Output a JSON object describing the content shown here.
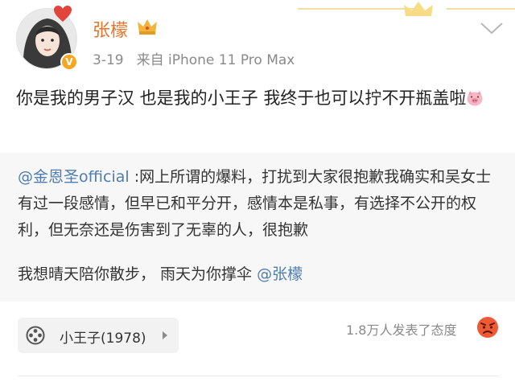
{
  "post": {
    "username": "张檬",
    "date": "3-19",
    "source": "来自 iPhone 11 Pro Max",
    "text": "你是我的男子汉 也是我的小王子 我终于也可以拧不开瓶盖啦"
  },
  "repost": {
    "mention": "@金恩圣official",
    "text": " :网上所谓的爆料，打扰到大家很抱歉我确实和吴女士有过一段感情，但早已和平分开，感情本是私事，有选择不公开的权利，但无奈还是伤害到了无辜的人，很抱歉",
    "quote_text": "我想晴天陪你散步，  雨天为你撑伞 ",
    "quote_mention": "@张檬"
  },
  "footer": {
    "music_title": "小王子(1978)",
    "reactions_text": "1.8万人发表了态度"
  },
  "colors": {
    "username": "#e5752a",
    "mention": "#507daf",
    "meta": "#8a8a8a",
    "repost_bg": "#f7f7f7",
    "badge": "#f5a623"
  },
  "icons": {
    "crown": "crown-icon",
    "pig": "pig-emoji-icon",
    "verified": "verified-v-icon",
    "chevron": "chevron-down-icon",
    "film": "film-reel-icon",
    "play": "play-icon",
    "angry": "angry-face-icon"
  }
}
